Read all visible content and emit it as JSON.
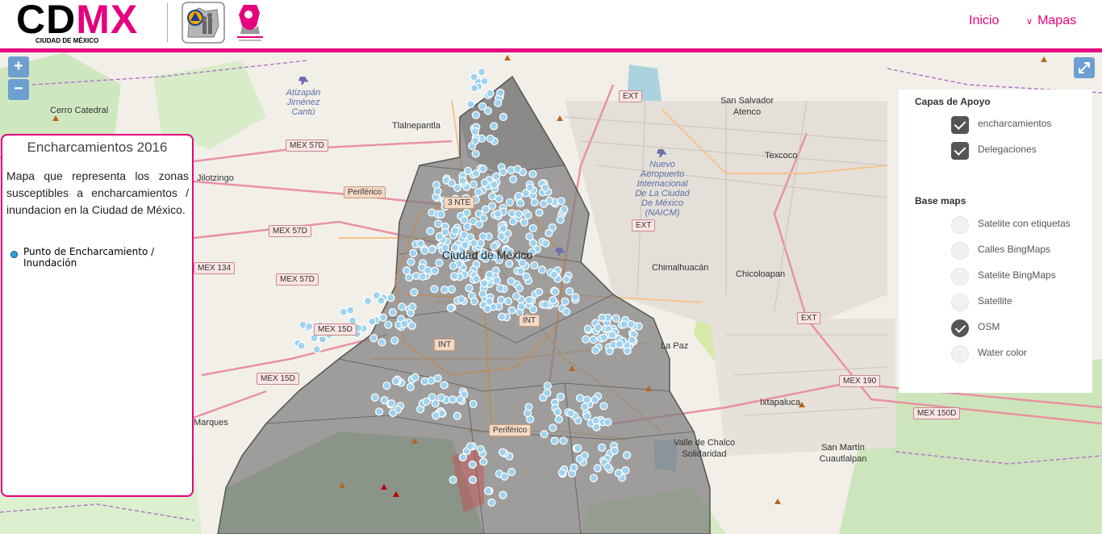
{
  "header": {
    "logo_main": "CD",
    "logo_accent": "MX",
    "logo_subtitle": "CIUDAD DE MÉXICO",
    "emblem1_icon": "proteccion-civil-emblem",
    "emblem2_icon": "atlas-riesgos-emblem",
    "accent_color": "#e6007e",
    "nav": {
      "inicio": "Inicio",
      "mapas": "Mapas"
    }
  },
  "map_controls": {
    "zoom_in": "+",
    "zoom_out": "−"
  },
  "legend": {
    "title": "Encharcamientos 2016",
    "description": "Mapa que representa los zonas susceptibles a encharcamientos / inundacion en la Ciudad de México.",
    "items": [
      {
        "label": "Punto de Encharcamiento / Inundación",
        "color": "#2f9fd8"
      }
    ]
  },
  "layers": {
    "support_title": "Capas de Apoyo",
    "support_layers": [
      {
        "label": "encharcamientos",
        "checked": true
      },
      {
        "label": "Delegaciones",
        "checked": true
      }
    ],
    "base_title": "Base maps",
    "base_maps": [
      {
        "label": "Satelite con etiquetas",
        "selected": false
      },
      {
        "label": "Calles BingMaps",
        "selected": false
      },
      {
        "label": "Satelite BingMaps",
        "selected": false
      },
      {
        "label": "Satellite",
        "selected": false
      },
      {
        "label": "OSM",
        "selected": true
      },
      {
        "label": "Water color",
        "selected": false
      }
    ]
  },
  "map_labels": {
    "cerro_catedral": "Cerro Catedral",
    "atizapan": "Atizapán Jiménez Cantú",
    "tlalnepantla": "Tlalnepantla",
    "jilotzingo": "Jilotzingo",
    "san_salvador": "San Salvador Atenco",
    "texcoco": "Texcoco",
    "aeropuerto": "Nuevo Aeropuerto Internacional De La Ciudad De México (NAICM)",
    "ciudad_mexico": "Ciudad de México",
    "chimalhuacan": "Chimalhuacán",
    "chicoloapan": "Chicoloapan",
    "la_paz": "La Paz",
    "ixtapaluca": "Ixtapaluca",
    "valle_chalco": "Valle de Chalco Solidaridad",
    "san_martin": "San Martín Cuautlalpan",
    "marques": "Marques"
  },
  "road_shields": {
    "ext1": "EXT",
    "ext2": "EXT",
    "ext3": "EXT",
    "mex57d_1": "MEX 57D",
    "mex57d_2": "MEX 57D",
    "mex57d_3": "MEX 57D",
    "periferico1": "Periférico",
    "periferico2": "Periférico",
    "nte": "3 NTE",
    "mex134": "MEX 134",
    "mex15d_1": "MEX 15D",
    "mex15d_2": "MEX 15D",
    "int1": "INT",
    "int2": "INT",
    "mex190": "MEX 190",
    "mex150d": "MEX 150D"
  }
}
